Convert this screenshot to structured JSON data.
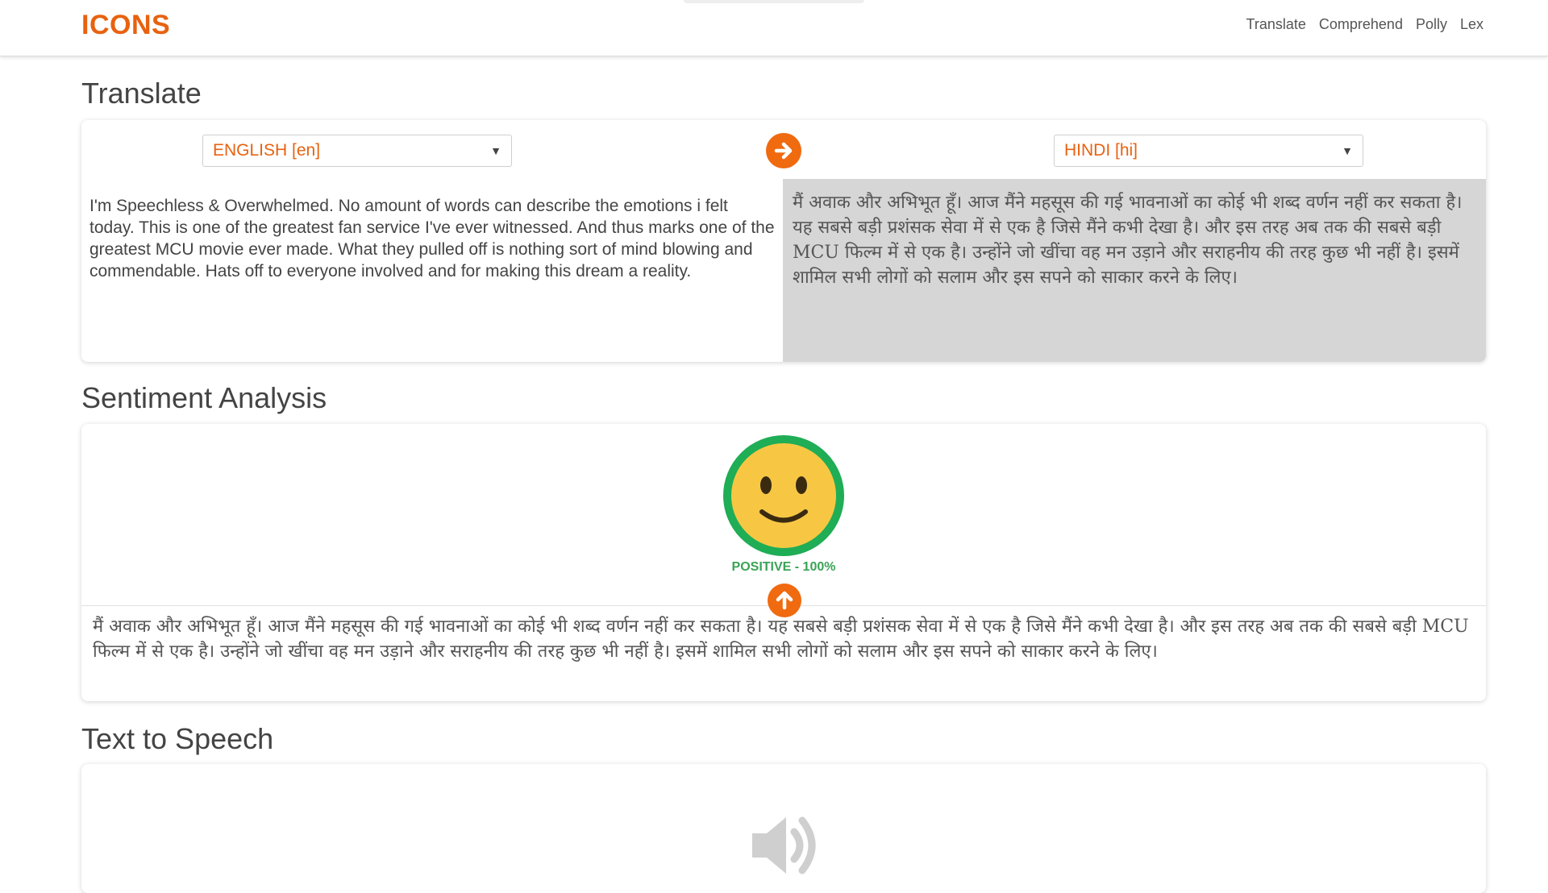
{
  "navbar": {
    "brand": "ICONS",
    "links": [
      "Translate",
      "Comprehend",
      "Polly",
      "Lex"
    ]
  },
  "translate": {
    "title": "Translate",
    "source_language": "ENGLISH [en]",
    "target_language": "HINDI [hi]",
    "source_text": "I'm Speechless & Overwhelmed. No amount of words can describe the emotions i felt today. This is one of the greatest fan service I've ever witnessed. And thus marks one of the greatest MCU movie ever made.  What they pulled off is nothing sort of mind blowing and commendable. Hats off to everyone involved and for making this dream a reality.",
    "translated_text": "मैं अवाक और अभिभूत हूँ। आज मैंने महसूस की गई भावनाओं का कोई भी शब्द वर्णन नहीं कर सकता है। यह सबसे बड़ी प्रशंसक सेवा में से एक है जिसे मैंने कभी देखा है। और इस तरह अब तक की सबसे बड़ी MCU फिल्म में से एक है। उन्होंने जो खींचा वह मन उड़ाने और सराहनीय की तरह कुछ भी नहीं है। इसमें शामिल सभी लोगों को सलाम और इस सपने को साकार करने के लिए।"
  },
  "sentiment": {
    "title": "Sentiment Analysis",
    "label": "POSITIVE - 100%",
    "score_percent": 100,
    "text": "मैं अवाक और अभिभूत हूँ। आज मैंने महसूस की गई भावनाओं का कोई भी शब्द वर्णन नहीं कर सकता है। यह सबसे बड़ी प्रशंसक सेवा में से एक है जिसे मैंने कभी देखा है। और इस तरह अब तक की सबसे बड़ी MCU फिल्म में से एक है। उन्होंने जो खींचा वह मन उड़ाने और सराहनीय की तरह कुछ भी नहीं है। इसमें शामिल सभी लोगों को सलाम और इस सपने को साकार करने के लिए।"
  },
  "tts": {
    "title": "Text to Speech"
  },
  "icons": {
    "translate_arrow": "arrow-right-icon",
    "sentiment_face": "smiley-face-icon",
    "send_up": "arrow-up-icon",
    "speaker": "speaker-icon",
    "dropdown": "chevron-down-icon"
  },
  "colors": {
    "brand": "#e8620f",
    "accent_button": "#f06a10",
    "positive": "#3aa356",
    "smiley_fill": "#f7c744",
    "smiley_ring": "#1fad55",
    "target_pane": "#d6d6d6"
  }
}
